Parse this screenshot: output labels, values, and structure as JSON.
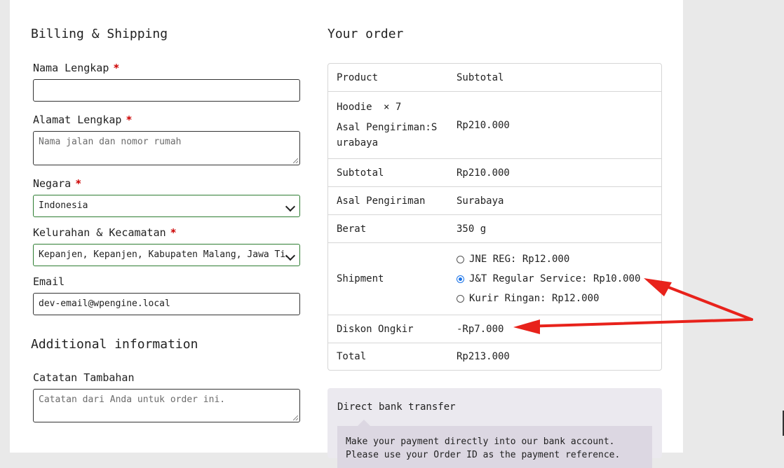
{
  "billing": {
    "heading": "Billing & Shipping",
    "name_label": "Nama Lengkap",
    "address_label": "Alamat Lengkap",
    "address_placeholder": "Nama jalan dan nomor rumah",
    "country_label": "Negara",
    "country_value": "Indonesia",
    "district_label": "Kelurahan & Kecamatan",
    "district_value": "Kepanjen, Kepanjen, Kabupaten Malang, Jawa Ti…",
    "email_label": "Email",
    "email_value": "dev-email@wpengine.local",
    "required_mark": "*"
  },
  "additional": {
    "heading": "Additional information",
    "notes_label": "Catatan Tambahan",
    "notes_placeholder": "Catatan dari Anda untuk order ini."
  },
  "order": {
    "heading": "Your order",
    "head_product": "Product",
    "head_subtotal": "Subtotal",
    "item_name": "Hoodie",
    "item_qty": "× 7",
    "item_origin_label": "Asal Pengiriman:",
    "item_origin_value": "Surabaya",
    "item_total": "Rp210.000",
    "subtotal_label": "Subtotal",
    "subtotal_value": "Rp210.000",
    "origin_label": "Asal Pengiriman",
    "origin_value": "Surabaya",
    "weight_label": "Berat",
    "weight_value": "350 g",
    "shipment_label": "Shipment",
    "shipment_options": [
      {
        "label": "JNE REG: Rp12.000",
        "selected": false
      },
      {
        "label": "J&T Regular Service: Rp10.000",
        "selected": true
      },
      {
        "label": "Kurir Ringan: Rp12.000",
        "selected": false
      }
    ],
    "discount_label": "Diskon Ongkir",
    "discount_value": "-Rp7.000",
    "total_label": "Total",
    "total_value": "Rp213.000"
  },
  "payment": {
    "method": "Direct bank transfer",
    "description": "Make your payment directly into our bank account. Please use your Order ID as the payment reference."
  },
  "annotation": {
    "arrow_color": "#e8221b"
  },
  "colors": {
    "valid_border": "#2e7d32",
    "required": "#cc0000",
    "radio_selected": "#1a73e8"
  }
}
